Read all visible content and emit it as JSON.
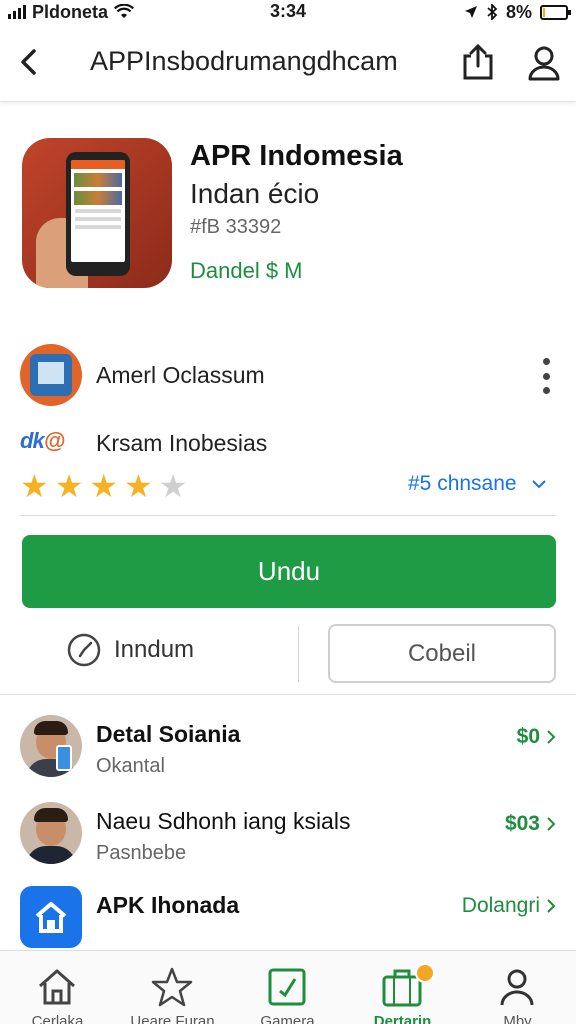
{
  "status_bar": {
    "carrier": "Pldoneta",
    "time": "3:34",
    "battery": "8%",
    "battery_level": 0.08
  },
  "nav": {
    "title": "APPInsbodrumangdhcam"
  },
  "app": {
    "name": "APR Indomesia",
    "subtitle": "Indan écio",
    "code": "#fB 33392",
    "meta": "Dandel $ M"
  },
  "developer": {
    "name": "Amerl Oclassum"
  },
  "publisher": {
    "logo_text": "dk",
    "logo_accent": "@",
    "name": "Krsam Inobesias",
    "rating": 4,
    "rating_max": 5,
    "version_link": "#5 chnsane"
  },
  "actions": {
    "primary_label": "Undu",
    "timer_label": "Inndum",
    "cancel_label": "Cobeil"
  },
  "list": [
    {
      "title": "Detal Soiania",
      "subtitle": "Okantal",
      "price": "$0"
    },
    {
      "title": "Naeu Sdhonh iang ksials",
      "subtitle": "Pasnbebe",
      "price": "$03"
    },
    {
      "title": "APK Ihonada",
      "subtitle": "",
      "price": "Dolangri"
    }
  ],
  "tabs": [
    {
      "label": "Cerlaka",
      "icon": "home-icon"
    },
    {
      "label": "Ueare Furan",
      "icon": "star-icon"
    },
    {
      "label": "Gamera",
      "icon": "check-box-icon"
    },
    {
      "label": "Dertarin",
      "icon": "briefcase-icon"
    },
    {
      "label": "Mby",
      "icon": "person-icon"
    }
  ],
  "colors": {
    "primary_green": "#1f9a45",
    "link_blue": "#1a73e8",
    "star_gold": "#f5b324",
    "badge_orange": "#f5a623"
  }
}
